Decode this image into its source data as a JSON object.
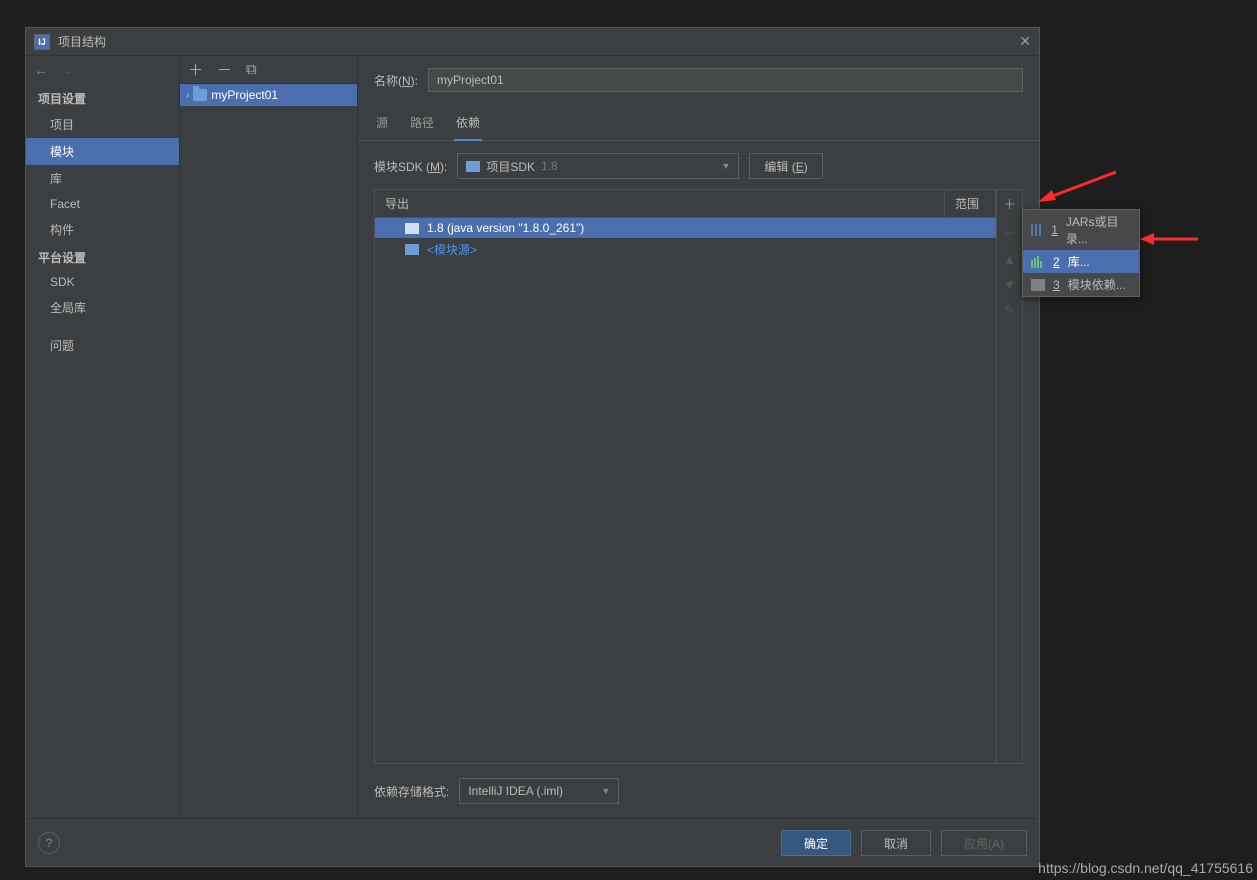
{
  "window": {
    "title": "项目结构"
  },
  "sidebar": {
    "section_project": "项目设置",
    "items_project": [
      "项目",
      "模块",
      "库",
      "Facet",
      "构件"
    ],
    "selected_project": 1,
    "section_platform": "平台设置",
    "items_platform": [
      "SDK",
      "全局库"
    ],
    "section_problems": "问题"
  },
  "tree": {
    "module_name": "myProject01"
  },
  "name": {
    "label": "名称(",
    "mnemonic": "N",
    "label_end": "):",
    "value": "myProject01"
  },
  "tabs": {
    "items": [
      "源",
      "路径",
      "依赖"
    ],
    "active": 2
  },
  "sdk": {
    "label": "模块SDK (",
    "mnemonic": "M",
    "label_end": "):",
    "selected_prefix": "项目SDK",
    "selected_version": "1.8",
    "edit": "编辑 (",
    "edit_mnemonic": "E",
    "edit_end": ")"
  },
  "table": {
    "header_export": "导出",
    "header_scope": "范围",
    "rows": [
      {
        "text": "1.8 (java version \"1.8.0_261\")",
        "selected": true
      },
      {
        "text": "<模块源>",
        "link": true
      }
    ]
  },
  "storage": {
    "label": "依赖存储格式:",
    "value": "IntelliJ IDEA (.iml)"
  },
  "footer": {
    "ok": "确定",
    "cancel": "取消",
    "apply": "应用(A)"
  },
  "popup": {
    "items": [
      {
        "num": "1",
        "label": "JARs或目录...",
        "icon": "jar"
      },
      {
        "num": "2",
        "label": "库...",
        "icon": "lib",
        "selected": true
      },
      {
        "num": "3",
        "label": "模块依赖...",
        "icon": "mod"
      }
    ]
  },
  "watermark": "https://blog.csdn.net/qq_41755616"
}
